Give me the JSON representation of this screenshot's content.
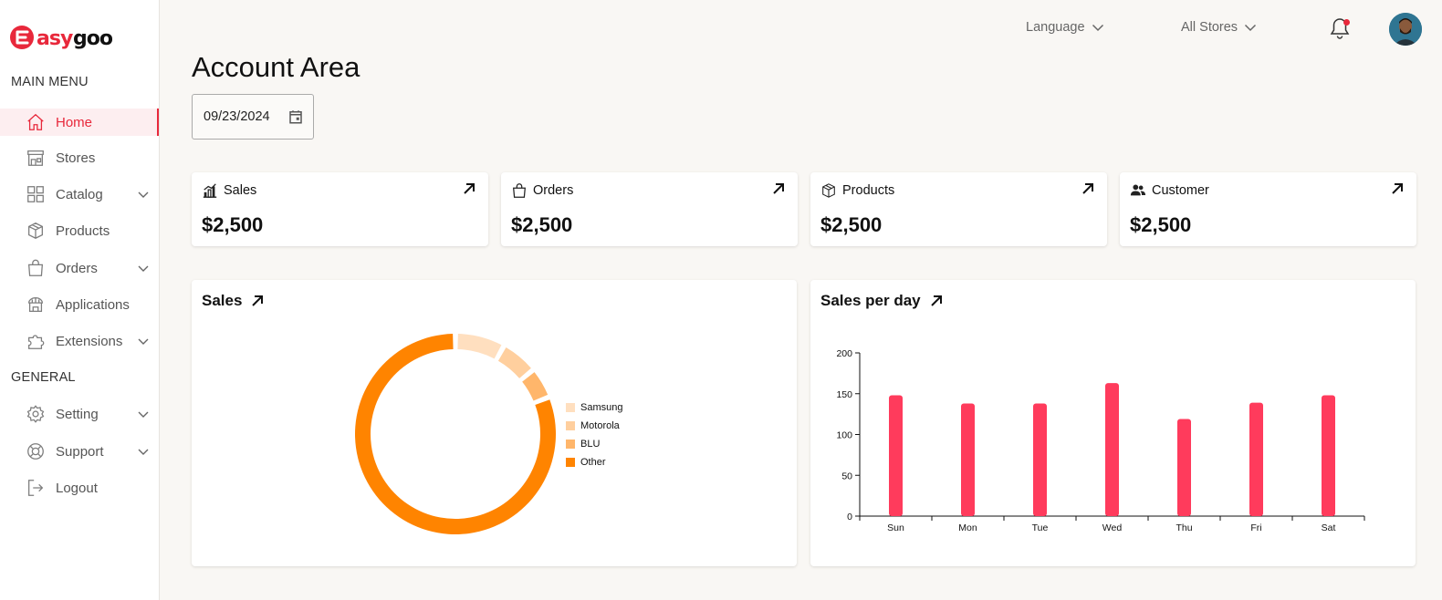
{
  "logo": {
    "text_main": "asygoo",
    "text_lead": "E"
  },
  "sidebar": {
    "main_menu_title": "MAIN MENU",
    "general_title": "GENERAL",
    "items": [
      {
        "label": "Home",
        "icon": "home-icon",
        "active": true,
        "expandable": false
      },
      {
        "label": "Stores",
        "icon": "store-icon",
        "active": false,
        "expandable": false
      },
      {
        "label": "Catalog",
        "icon": "grid-icon",
        "active": false,
        "expandable": true
      },
      {
        "label": "Products",
        "icon": "box-icon",
        "active": false,
        "expandable": false
      },
      {
        "label": "Orders",
        "icon": "bag-icon",
        "active": false,
        "expandable": true
      },
      {
        "label": "Applications",
        "icon": "app-store-icon",
        "active": false,
        "expandable": false
      },
      {
        "label": "Extensions",
        "icon": "puzzle-icon",
        "active": false,
        "expandable": true
      },
      {
        "label": "Setting",
        "icon": "gear-icon",
        "active": false,
        "expandable": true
      },
      {
        "label": "Support",
        "icon": "lifebuoy-icon",
        "active": false,
        "expandable": true
      },
      {
        "label": "Logout",
        "icon": "logout-icon",
        "active": false,
        "expandable": false
      }
    ]
  },
  "topbar": {
    "language_label": "Language",
    "stores_label": "All Stores",
    "notification_dot": true
  },
  "page": {
    "title": "Account Area",
    "date_value": "09/23/2024"
  },
  "stats": [
    {
      "label": "Sales",
      "value": "$2,500",
      "icon": "bar-chart-icon"
    },
    {
      "label": "Orders",
      "value": "$2,500",
      "icon": "bag-icon"
    },
    {
      "label": "Products",
      "value": "$2,500",
      "icon": "box-icon"
    },
    {
      "label": "Customer",
      "value": "$2,500",
      "icon": "users-icon"
    }
  ],
  "sales_card": {
    "title": "Sales"
  },
  "sales_per_day_card": {
    "title": "Sales per day"
  },
  "colors": {
    "accent": "#e8283b",
    "bar": "#ff3b5c",
    "donut": [
      "#ffdfbf",
      "#ffcf9e",
      "#ffb66b",
      "#ff8400"
    ]
  },
  "chart_data": [
    {
      "type": "pie",
      "variant": "donut",
      "categories": [
        "Samsung",
        "Motorola",
        "BLU",
        "Other"
      ],
      "values": [
        8,
        6,
        5,
        81
      ],
      "legend": "right",
      "title": ""
    },
    {
      "type": "bar",
      "categories": [
        "Sun",
        "Mon",
        "Tue",
        "Wed",
        "Thu",
        "Fri",
        "Sat"
      ],
      "values": [
        148,
        138,
        138,
        163,
        119,
        139,
        148
      ],
      "ylim": [
        0,
        200
      ],
      "yticks": [
        0,
        50,
        100,
        150,
        200
      ],
      "grid": false,
      "title": ""
    }
  ]
}
